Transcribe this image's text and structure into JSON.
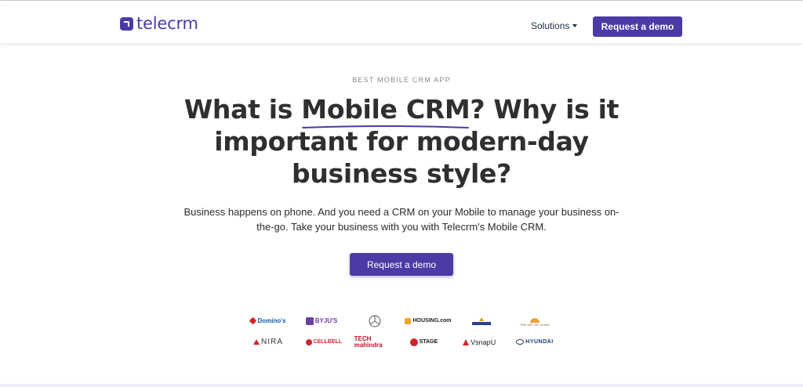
{
  "header": {
    "logo_text": "telecrm",
    "nav": {
      "solutions_label": "Solutions"
    },
    "cta_label": "Request a demo"
  },
  "hero": {
    "kicker": "BEST MOBILE CRM APP",
    "headline_before": "What is ",
    "headline_highlight": "Mobile CRM",
    "headline_after": "? Why is it important for modern-day business style?",
    "subcopy": "Business happens on phone. And you need a CRM on your Mobile to manage your business on-the-go. Take your business with you with Telecrm's Mobile CRM.",
    "cta_label": "Request a demo"
  },
  "clients": {
    "row1": [
      "Domino's",
      "BYJU'S",
      "",
      "HOUSING.com",
      "",
      "THE ART OF LIVING"
    ],
    "row2": [
      "NIRA",
      "CELLBELL",
      "TECH mahindra",
      "STAGE",
      "VsnapU",
      "HYUNDAI"
    ]
  },
  "colors": {
    "brand": "#4a3ba6",
    "text": "#2b2b2b"
  }
}
